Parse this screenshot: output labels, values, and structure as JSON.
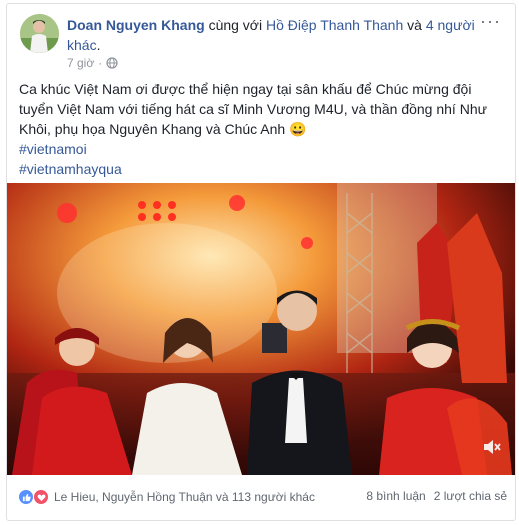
{
  "post": {
    "author": "Doan Nguyen Khang",
    "with_text": "cùng với",
    "tagged_person": "Hồ Điệp Thanh Thanh",
    "and_text": "và",
    "others_link": "4 người khác",
    "period": ".",
    "time": "7 giờ",
    "privacy_icon": "globe-icon",
    "text": "Ca khúc Việt Nam ơi được thể hiện ngay tại sân khấu để Chúc mừng đội tuyển Việt Nam với tiếng hát ca sĩ Minh Vương M4U, và thần đồng nhí Như Khôi, phụ họa Nguyên Khang và Chúc Anh 😀",
    "hashtags": [
      "#vietnamoi",
      "#vietnamhayqua"
    ]
  },
  "video": {
    "sound_icon": "speaker-icon"
  },
  "footer": {
    "reactions_text": "Le Hieu, Nguyễn Hồng Thuận và 113 người khác",
    "comments": "8 bình luận",
    "shares": "2 lượt chia sẻ"
  },
  "colors": {
    "link": "#365899",
    "text": "#1d2129",
    "like": "#5890ff",
    "love": "#f25268"
  }
}
